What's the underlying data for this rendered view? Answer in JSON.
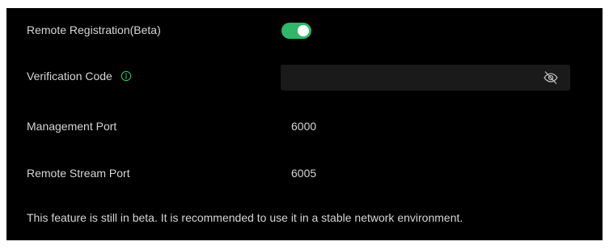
{
  "settings": {
    "remote_registration": {
      "label": "Remote Registration(Beta)",
      "enabled": true
    },
    "verification_code": {
      "label": "Verification Code",
      "value": "",
      "info_icon": "info-icon",
      "visibility_icon": "eye-slash-icon"
    },
    "management_port": {
      "label": "Management Port",
      "value": "6000"
    },
    "remote_stream_port": {
      "label": "Remote Stream Port",
      "value": "6005"
    },
    "note": "This feature is still in beta. It is recommended to use it in a stable network environment."
  },
  "colors": {
    "background": "#000000",
    "accent": "#2fb86a",
    "text": "#d6d6d6",
    "field_background": "#1a1a1a"
  }
}
